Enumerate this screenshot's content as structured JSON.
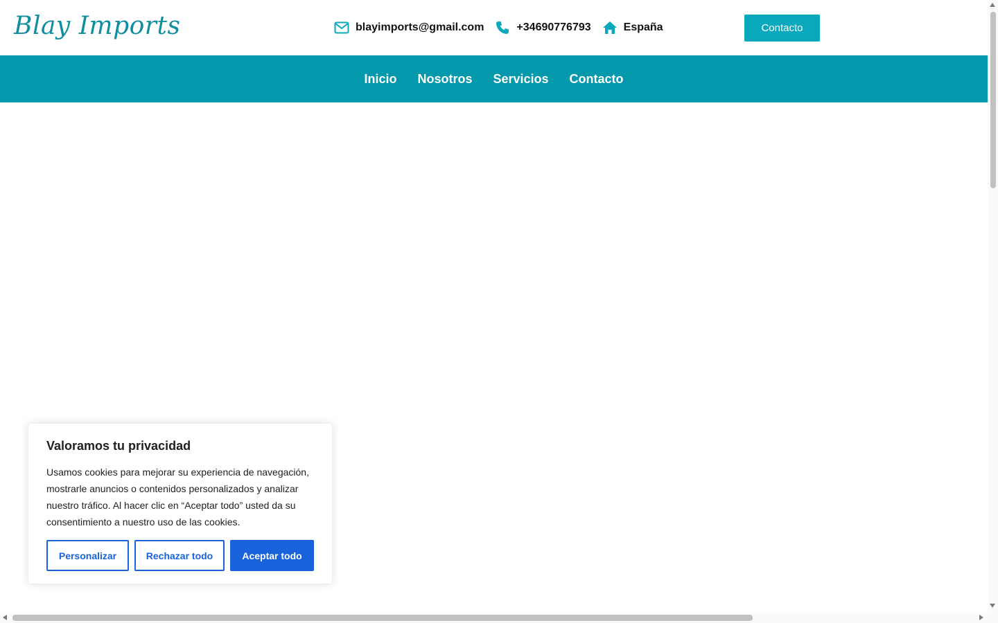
{
  "header": {
    "logo_text": "Blay Imports",
    "email": "blayimports@gmail.com",
    "phone": "+34690776793",
    "country": "España",
    "contact_button": "Contacto",
    "icons": {
      "email": "envelope-icon",
      "phone": "phone-icon",
      "country": "home-icon"
    }
  },
  "nav": {
    "items": [
      {
        "label": "Inicio"
      },
      {
        "label": "Nosotros"
      },
      {
        "label": "Servicios"
      },
      {
        "label": "Contacto"
      }
    ]
  },
  "cookie_banner": {
    "title": "Valoramos tu privacidad",
    "text": "Usamos cookies para mejorar su experiencia de navegación, mostrarle anuncios o contenidos personalizados y analizar nuestro tráfico. Al hacer clic en “Aceptar todo” usted da su consentimiento a nuestro uso de las cookies.",
    "customize_label": "Personalizar",
    "reject_label": "Rechazar todo",
    "accept_label": "Aceptar todo"
  },
  "colors": {
    "brand": "#0498ad",
    "button": "#0aa8bd",
    "cookie_accent": "#1863dc"
  }
}
